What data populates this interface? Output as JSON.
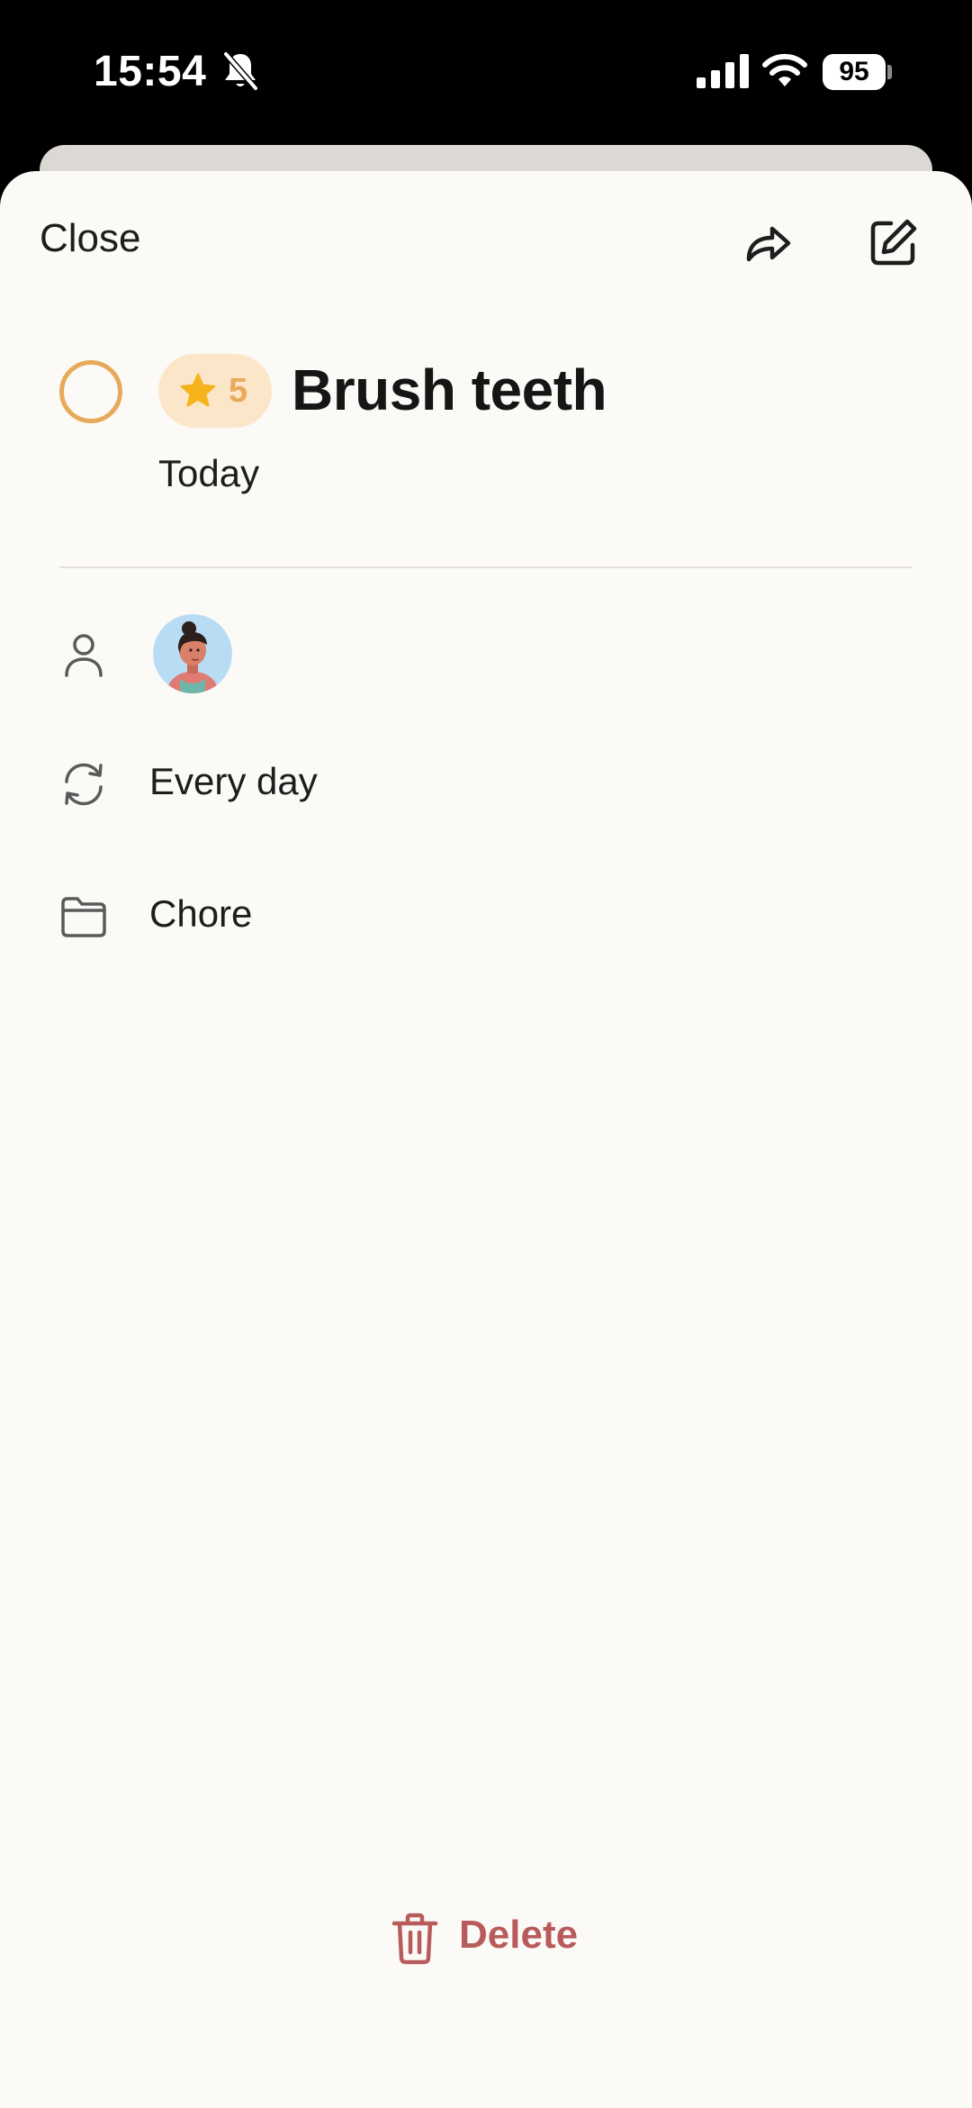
{
  "status_bar": {
    "time": "15:54",
    "battery": "95",
    "icons": [
      "bell-slash-icon",
      "cellular-signal-icon",
      "wifi-icon",
      "battery-icon"
    ]
  },
  "header": {
    "close_label": "Close",
    "share_icon": "share-arrow-icon",
    "edit_icon": "edit-icon"
  },
  "task": {
    "points": "5",
    "title": "Brush teeth",
    "due": "Today",
    "completed": false
  },
  "details": {
    "assignee_icon": "person-icon",
    "assignee_avatar": "avatar",
    "repeat": "Every day",
    "repeat_icon": "repeat-icon",
    "category": "Chore",
    "category_icon": "folder-icon"
  },
  "footer": {
    "delete_label": "Delete",
    "delete_icon": "trash-icon"
  },
  "colors": {
    "accent": "#e8a95a",
    "badge_bg": "#fbe6ca",
    "star": "#f6b31b",
    "danger": "#b85c5b",
    "sheet_bg": "#fbfaf7"
  }
}
